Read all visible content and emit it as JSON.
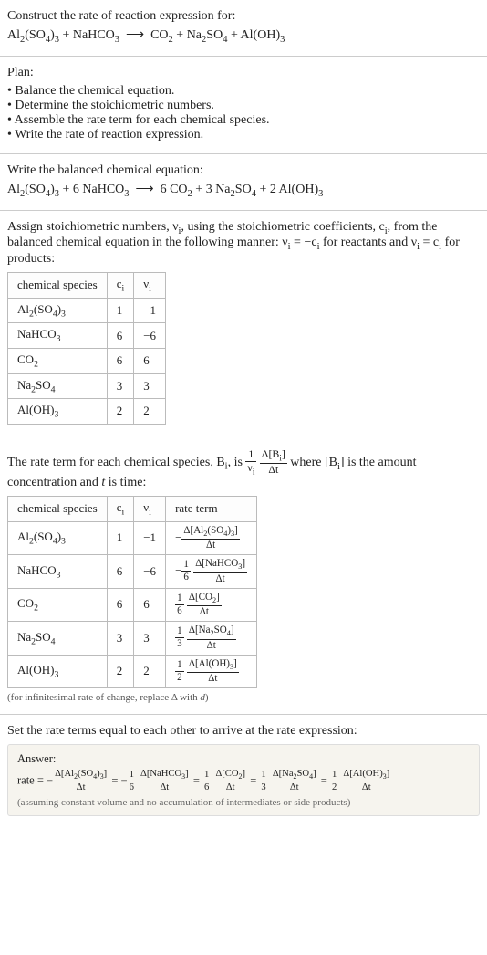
{
  "intro": {
    "prompt": "Construct the rate of reaction expression for:",
    "unbalanced_eq_html": "Al<sub>2</sub>(SO<sub>4</sub>)<sub>3</sub> + NaHCO<sub>3</sub> &nbsp;⟶&nbsp; CO<sub>2</sub> + Na<sub>2</sub>SO<sub>4</sub> + Al(OH)<sub>3</sub>"
  },
  "plan": {
    "heading": "Plan:",
    "items": [
      "Balance the chemical equation.",
      "Determine the stoichiometric numbers.",
      "Assemble the rate term for each chemical species.",
      "Write the rate of reaction expression."
    ]
  },
  "balanced": {
    "heading": "Write the balanced chemical equation:",
    "eq_html": "Al<sub>2</sub>(SO<sub>4</sub>)<sub>3</sub> + 6 NaHCO<sub>3</sub> &nbsp;⟶&nbsp; 6 CO<sub>2</sub> + 3 Na<sub>2</sub>SO<sub>4</sub> + 2 Al(OH)<sub>3</sub>"
  },
  "stoich": {
    "intro_html": "Assign stoichiometric numbers, ν<sub>i</sub>, using the stoichiometric coefficients, c<sub>i</sub>, from the balanced chemical equation in the following manner: ν<sub>i</sub> = −c<sub>i</sub> for reactants and ν<sub>i</sub> = c<sub>i</sub> for products:",
    "headers": {
      "species": "chemical species",
      "ci_html": "c<sub>i</sub>",
      "vi_html": "ν<sub>i</sub>"
    },
    "rows": [
      {
        "species_html": "Al<sub>2</sub>(SO<sub>4</sub>)<sub>3</sub>",
        "ci": "1",
        "vi": "−1"
      },
      {
        "species_html": "NaHCO<sub>3</sub>",
        "ci": "6",
        "vi": "−6"
      },
      {
        "species_html": "CO<sub>2</sub>",
        "ci": "6",
        "vi": "6"
      },
      {
        "species_html": "Na<sub>2</sub>SO<sub>4</sub>",
        "ci": "3",
        "vi": "3"
      },
      {
        "species_html": "Al(OH)<sub>3</sub>",
        "ci": "2",
        "vi": "2"
      }
    ]
  },
  "rateterms": {
    "intro_pre": "The rate term for each chemical species, B",
    "intro_mid": ", is ",
    "intro_post_html": " where [B<sub>i</sub>] is the amount concentration and <i>t</i> is time:",
    "headers": {
      "species": "chemical species",
      "ci_html": "c<sub>i</sub>",
      "vi_html": "ν<sub>i</sub>",
      "rate": "rate term"
    },
    "rows": [
      {
        "species_html": "Al<sub>2</sub>(SO<sub>4</sub>)<sub>3</sub>",
        "ci": "1",
        "vi": "−1",
        "rate_neg": true,
        "rate_coef_num": "",
        "rate_coef_den": "",
        "rate_delta_html": "Δ[Al<sub>2</sub>(SO<sub>4</sub>)<sub>3</sub>]"
      },
      {
        "species_html": "NaHCO<sub>3</sub>",
        "ci": "6",
        "vi": "−6",
        "rate_neg": true,
        "rate_coef_num": "1",
        "rate_coef_den": "6",
        "rate_delta_html": "Δ[NaHCO<sub>3</sub>]"
      },
      {
        "species_html": "CO<sub>2</sub>",
        "ci": "6",
        "vi": "6",
        "rate_neg": false,
        "rate_coef_num": "1",
        "rate_coef_den": "6",
        "rate_delta_html": "Δ[CO<sub>2</sub>]"
      },
      {
        "species_html": "Na<sub>2</sub>SO<sub>4</sub>",
        "ci": "3",
        "vi": "3",
        "rate_neg": false,
        "rate_coef_num": "1",
        "rate_coef_den": "3",
        "rate_delta_html": "Δ[Na<sub>2</sub>SO<sub>4</sub>]"
      },
      {
        "species_html": "Al(OH)<sub>3</sub>",
        "ci": "2",
        "vi": "2",
        "rate_neg": false,
        "rate_coef_num": "1",
        "rate_coef_den": "2",
        "rate_delta_html": "Δ[Al(OH)<sub>3</sub>]"
      }
    ],
    "note_html": "(for infinitesimal rate of change, replace Δ with <i>d</i>)"
  },
  "final": {
    "heading": "Set the rate terms equal to each other to arrive at the rate expression:",
    "answer_label": "Answer:",
    "rate_word": "rate = ",
    "assume": "(assuming constant volume and no accumulation of intermediates or side products)"
  }
}
